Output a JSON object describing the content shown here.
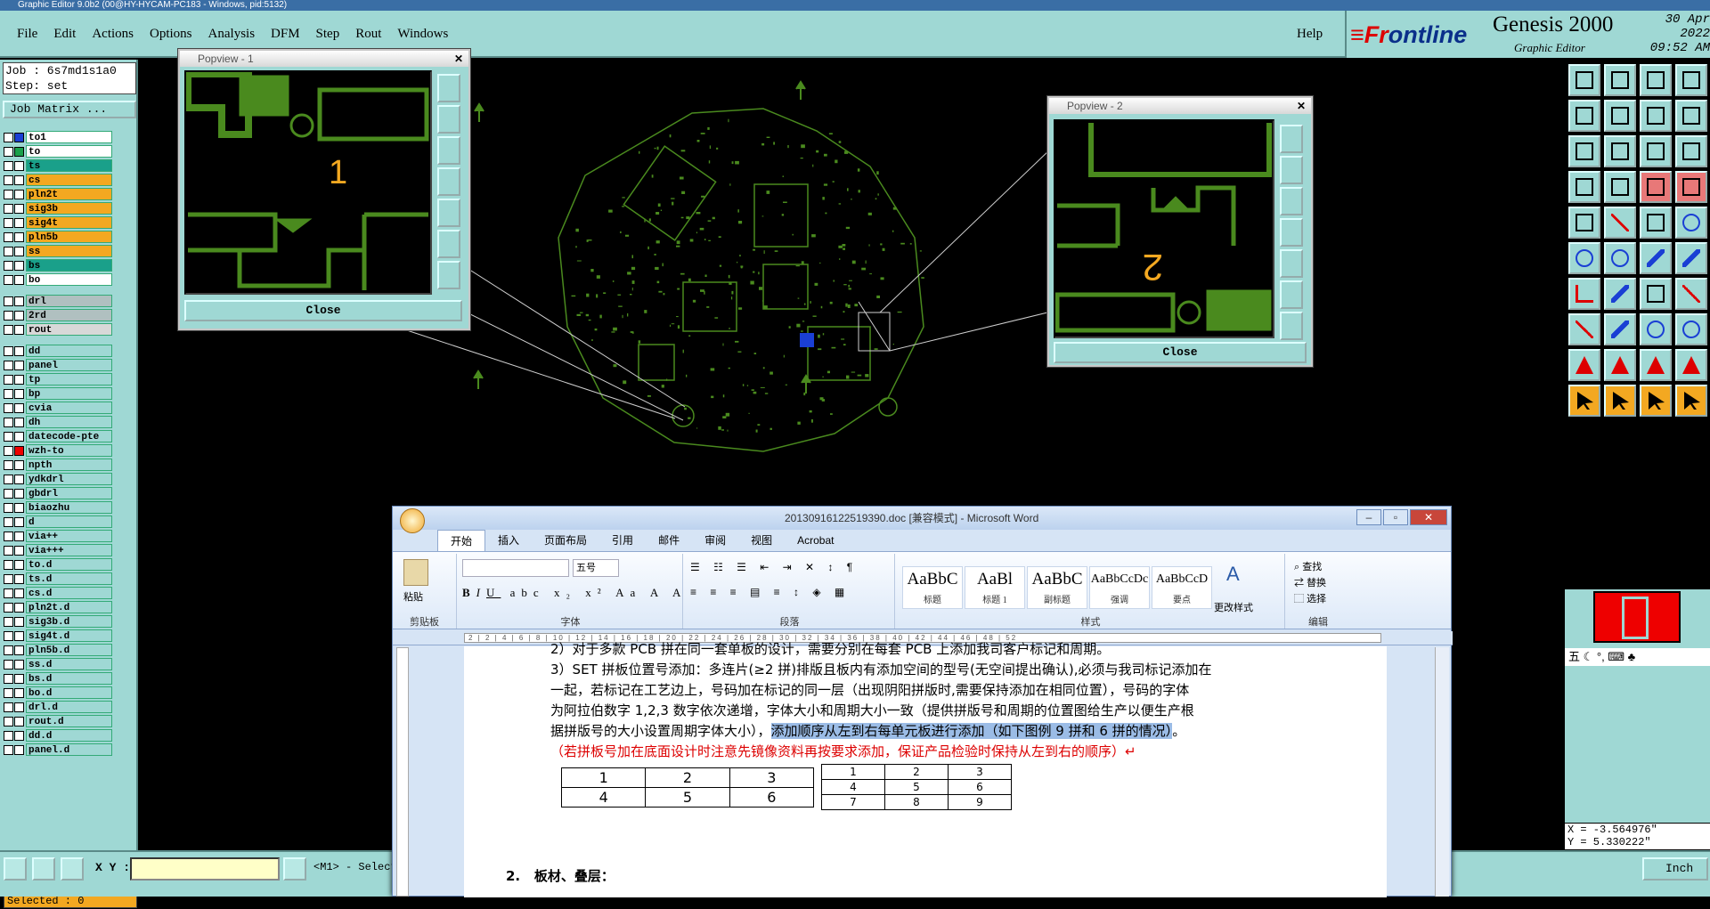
{
  "window_title": "Graphic Editor 9.0b2 (00@HY-HYCAM-PC183 - Windows, pid:5132)",
  "menu": {
    "items": [
      "File",
      "Edit",
      "Actions",
      "Options",
      "Analysis",
      "DFM",
      "Step",
      "Rout",
      "Windows"
    ],
    "help": "Help"
  },
  "brand": {
    "logo_pre": "≡Fr",
    "logo_o": "o",
    "logo_post": "ntline",
    "product": "Genesis 2000",
    "subtitle": "Graphic Editor",
    "date": "30 Apr 2022",
    "time": "09:52 AM"
  },
  "job": {
    "job_line": "Job : 6s7md1s1a0",
    "step_line": "Step: set",
    "matrix_button": "Job Matrix ...",
    "selected": "Selected : 0"
  },
  "layers": [
    {
      "name": "to1",
      "swatch": "#1a3fd4",
      "color": "#fff"
    },
    {
      "name": "to",
      "swatch": "#1aa04a",
      "color": "#fff"
    },
    {
      "name": "ts",
      "swatch": "#fff",
      "color": "#1aa08a"
    },
    {
      "name": "cs",
      "swatch": "#fff",
      "color": "#f3a821"
    },
    {
      "name": "pln2t",
      "swatch": "#fff",
      "color": "#f3a821"
    },
    {
      "name": "sig3b",
      "swatch": "#fff",
      "color": "#f3a821"
    },
    {
      "name": "sig4t",
      "swatch": "#fff",
      "color": "#f3a821"
    },
    {
      "name": "pln5b",
      "swatch": "#fff",
      "color": "#f3a821"
    },
    {
      "name": "ss",
      "swatch": "#fff",
      "color": "#f3a821"
    },
    {
      "name": "bs",
      "swatch": "#fff",
      "color": "#1aa08a"
    },
    {
      "name": "bo",
      "swatch": "#fff",
      "color": "#fff"
    },
    {
      "name": "drl",
      "swatch": "#fff",
      "color": "#b0c0c0"
    },
    {
      "name": "2rd",
      "swatch": "#fff",
      "color": "#b0c0c0"
    },
    {
      "name": "rout",
      "swatch": "#fff",
      "color": "#d8d8d8"
    },
    {
      "name": "dd",
      "swatch": "#fff",
      "color": "#9fd8d4"
    },
    {
      "name": "panel",
      "swatch": "#fff",
      "color": "#9fd8d4"
    },
    {
      "name": "tp",
      "swatch": "#fff",
      "color": "#9fd8d4"
    },
    {
      "name": "bp",
      "swatch": "#fff",
      "color": "#9fd8d4"
    },
    {
      "name": "cvia",
      "swatch": "#fff",
      "color": "#9fd8d4"
    },
    {
      "name": "dh",
      "swatch": "#fff",
      "color": "#9fd8d4"
    },
    {
      "name": "datecode-pte",
      "swatch": "#fff",
      "color": "#9fd8d4"
    },
    {
      "name": "wzh-to",
      "swatch": "#e00",
      "color": "#9fd8d4"
    },
    {
      "name": "npth",
      "swatch": "#fff",
      "color": "#9fd8d4"
    },
    {
      "name": "ydkdrl",
      "swatch": "#fff",
      "color": "#9fd8d4"
    },
    {
      "name": "gbdrl",
      "swatch": "#fff",
      "color": "#9fd8d4"
    },
    {
      "name": "biaozhu",
      "swatch": "#fff",
      "color": "#9fd8d4"
    },
    {
      "name": "d",
      "swatch": "#fff",
      "color": "#9fd8d4"
    },
    {
      "name": "via++",
      "swatch": "#fff",
      "color": "#9fd8d4"
    },
    {
      "name": "via+++",
      "swatch": "#fff",
      "color": "#9fd8d4"
    },
    {
      "name": "to.d",
      "swatch": "#fff",
      "color": "#9fd8d4"
    },
    {
      "name": "ts.d",
      "swatch": "#fff",
      "color": "#9fd8d4"
    },
    {
      "name": "cs.d",
      "swatch": "#fff",
      "color": "#9fd8d4"
    },
    {
      "name": "pln2t.d",
      "swatch": "#fff",
      "color": "#9fd8d4"
    },
    {
      "name": "sig3b.d",
      "swatch": "#fff",
      "color": "#9fd8d4"
    },
    {
      "name": "sig4t.d",
      "swatch": "#fff",
      "color": "#9fd8d4"
    },
    {
      "name": "pln5b.d",
      "swatch": "#fff",
      "color": "#9fd8d4"
    },
    {
      "name": "ss.d",
      "swatch": "#fff",
      "color": "#9fd8d4"
    },
    {
      "name": "bs.d",
      "swatch": "#fff",
      "color": "#9fd8d4"
    },
    {
      "name": "bo.d",
      "swatch": "#fff",
      "color": "#9fd8d4"
    },
    {
      "name": "drl.d",
      "swatch": "#fff",
      "color": "#9fd8d4"
    },
    {
      "name": "rout.d",
      "swatch": "#fff",
      "color": "#9fd8d4"
    },
    {
      "name": "dd.d",
      "swatch": "#fff",
      "color": "#9fd8d4"
    },
    {
      "name": "panel.d",
      "swatch": "#fff",
      "color": "#9fd8d4"
    }
  ],
  "popview1": {
    "title": "Popview - 1",
    "close": "Close",
    "digit": "1"
  },
  "popview2": {
    "title": "Popview - 2",
    "close": "Close",
    "digit": "2"
  },
  "bottom": {
    "xy_label": "X Y :",
    "mode": "<M1> - Select",
    "unit": "Inch"
  },
  "coords": {
    "x": "X = -3.564976\"",
    "y": "Y = 5.330222\""
  },
  "ime": "五 ☾ °, ⌨ ♣",
  "word": {
    "title": "20130916122519390.doc [兼容模式] - Microsoft Word",
    "tabs": [
      "开始",
      "插入",
      "页面布局",
      "引用",
      "邮件",
      "审阅",
      "视图",
      "Acrobat"
    ],
    "groups": {
      "clipboard": "剪贴板",
      "font": "字体",
      "paragraph": "段落",
      "styles": "样式",
      "editing": "编辑"
    },
    "paste": "粘贴",
    "font_size": "五号",
    "styles": [
      {
        "sample": "AaBbC",
        "label": "标题"
      },
      {
        "sample": "AaBl",
        "label": "标题 1"
      },
      {
        "sample": "AaBbC",
        "label": "副标题"
      },
      {
        "sample": "AaBbCcDc",
        "label": "强调"
      },
      {
        "sample": "AaBbCcD",
        "label": "要点"
      }
    ],
    "change_styles": "更改样式",
    "find": "查找",
    "replace": "替换",
    "select": "选择",
    "ruler": "2 | 2 | 4 | 6 | 8 | 10 | 12 | 14 | 16 | 18 | 20 | 22 | 24 | 26 | 28 | 30 | 32 | 34 | 36 | 38 | 40 | 42 | 44 | 46 | 48 | 52",
    "lines": {
      "l0": "2）对于多款 PCB 拼在同一套单板的设计，需要分别在每套 PCB 上添加我司客户标记和周期。",
      "l1": "3）SET 拼板位置号添加：多连片(≥2 拼)排版且板内有添加空间的型号(无空间提出确认),必须与我司标记添加在",
      "l2": "一起，若标记在工艺边上，号码加在标记的同一层（出现阴阳拼版时,需要保持添加在相同位置），号码的字体",
      "l3": "为阿拉伯数字  1,2,3  数字依次递增，字体大小和周期大小一致（提供拼版号和周期的位置图给生产以便生产根",
      "l4a": "据拼版号的大小设置周期字体大小），",
      "l4b": "添加顺序从左到右每单元板进行添加（如下图例 9 拼和 6 拼的情况）",
      "l4c": "。",
      "l5": "（若拼板号加在底面设计时注意先镜像资料再按要求添加，保证产品检验时保持从左到右的顺序）↵",
      "heading_num": "2.",
      "heading": "板材、叠层："
    },
    "table6": [
      [
        "1",
        "2",
        "3"
      ],
      [
        "4",
        "5",
        "6"
      ]
    ],
    "table9": [
      [
        "1",
        "2",
        "3"
      ],
      [
        "4",
        "5",
        "6"
      ],
      [
        "7",
        "8",
        "9"
      ]
    ]
  }
}
